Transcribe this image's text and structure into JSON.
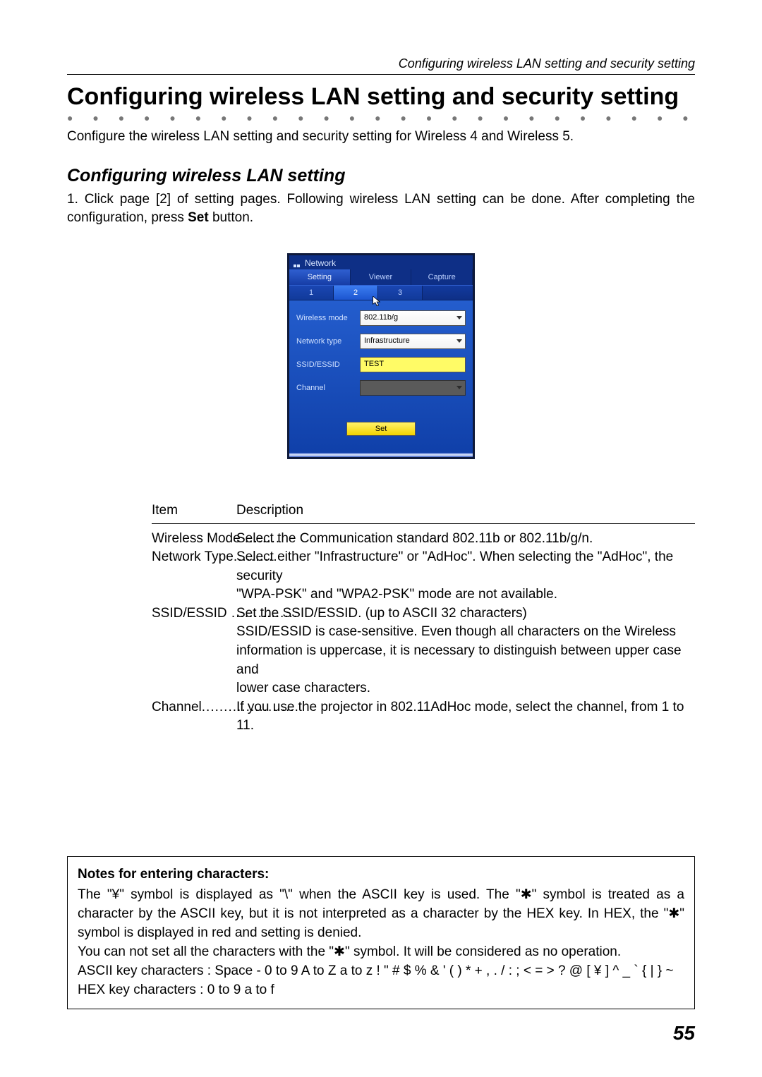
{
  "running_head": "Configuring wireless LAN setting and security setting",
  "heading": "Configuring wireless LAN setting and security setting",
  "lead": "Configure the wireless LAN setting and security setting for Wireless 4 and Wireless 5.",
  "sub_heading": "Configuring wireless LAN setting",
  "step_text_pre": "1. Click page [2] of setting pages. Following wireless LAN setting can be done. After completing the configuration, press ",
  "step_bold": "Set",
  "step_text_post": " button.",
  "shot": {
    "title": "Network",
    "tabs": {
      "setting": "Setting",
      "viewer": "Viewer",
      "capture": "Capture"
    },
    "pages": {
      "p1": "1",
      "p2": "2",
      "p3": "3"
    },
    "rows": {
      "wireless_mode": {
        "label": "Wireless mode",
        "value": "802.11b/g"
      },
      "network_type": {
        "label": "Network type",
        "value": "Infrastructure"
      },
      "ssid": {
        "label": "SSID/ESSID",
        "value": "TEST"
      },
      "channel": {
        "label": "Channel",
        "value": ""
      }
    },
    "set_button": "Set"
  },
  "desc": {
    "head_item": "Item",
    "head_desc": "Description",
    "rows": {
      "wm_label": "Wireless Mode",
      "wm_dots": " ........",
      "wm_desc": "Select the Communication standard 802.11b or 802.11b/g/n.",
      "nt_label": "Network Type",
      "nt_dots": "..........",
      "nt_desc": "Select either \"Infrastructure\" or \"AdHoc\". When selecting the \"AdHoc\", the security",
      "nt_desc2": "\"WPA-PSK\" and \"WPA2-PSK\" mode are not available.",
      "ss_label": "SSID/ESSID",
      "ss_dots": " ...............",
      "ss_desc": "Set the SSID/ESSID. (up to ASCII 32 characters)",
      "ss_desc2": "SSID/ESSID is case-sensitive. Even though all characters on the Wireless",
      "ss_desc3": "information is uppercase, it is necessary to distinguish between upper case and",
      "ss_desc4": "lower case characters.",
      "ch_label": "Channel",
      "ch_dots": "......................",
      "ch_desc": "If you use the projector in 802.11AdHoc mode, select the channel, from 1 to 11."
    }
  },
  "notes": {
    "title": "Notes for entering characters:",
    "l1": "The \"¥\" symbol is displayed as \"\\\" when the ASCII key is used. The \"✱\" symbol is treated as a character by the ASCII key, but it is not interpreted as a character by the HEX key. In HEX, the \"✱\" symbol is displayed in red and setting is denied.",
    "l2": "You can not set all the characters with the \"✱\" symbol. It will be considered as no operation.",
    "l3": "ASCII key characters : Space - 0 to 9 A to Z a to z ! \" # $ % & ' ( ) * + , . / : ; < = > ? @ [ ¥ ] ^ _ ` { | } ~",
    "l4": "HEX key characters : 0 to 9 a to f"
  },
  "page_number": "55"
}
